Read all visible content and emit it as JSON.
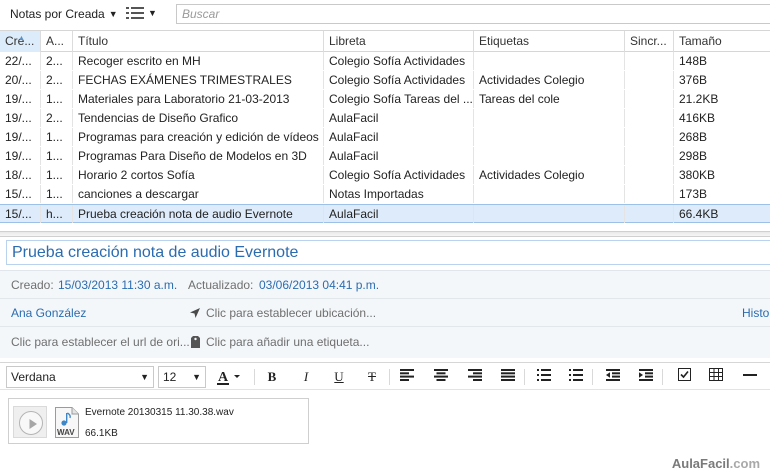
{
  "toolbar": {
    "sort_label": "Notas por Creada",
    "view_icon": "list-view-icon",
    "search_placeholder": "Buscar"
  },
  "table": {
    "columns": [
      "Cre...",
      "A...",
      "Título",
      "Libreta",
      "Etiquetas",
      "Sincr...",
      "Tamaño"
    ],
    "rows": [
      [
        "22/...",
        "2...",
        "Recoger escrito en MH",
        "Colegio Sofía Actividades",
        "",
        "",
        "148B"
      ],
      [
        "20/...",
        "2...",
        "FECHAS EXÁMENES TRIMESTRALES",
        "Colegio Sofía Actividades",
        "Actividades Colegio",
        "",
        "376B"
      ],
      [
        "19/...",
        "1...",
        "Materiales para Laboratorio 21-03-2013",
        "Colegio Sofía Tareas del ...",
        "Tareas del cole",
        "",
        "21.2KB"
      ],
      [
        "19/...",
        "2...",
        "Tendencias de Diseño Grafico",
        "AulaFacil",
        "",
        "",
        "416KB"
      ],
      [
        "19/...",
        "1...",
        "Programas para creación y edición de vídeos",
        "AulaFacil",
        "",
        "",
        "268B"
      ],
      [
        "19/...",
        "1...",
        "Programas Para Diseño de Modelos en 3D",
        "AulaFacil",
        "",
        "",
        "298B"
      ],
      [
        "18/...",
        "1...",
        "Horario 2 cortos Sofía",
        "Colegio Sofía Actividades",
        "Actividades Colegio",
        "",
        "380KB"
      ],
      [
        "15/...",
        "1...",
        "canciones a descargar",
        "Notas Importadas",
        "",
        "",
        "173B"
      ],
      [
        "15/...",
        "h...",
        "Prueba creación nota de audio Evernote",
        "AulaFacil",
        "",
        "",
        "66.4KB"
      ]
    ]
  },
  "note": {
    "title": "Prueba creación nota de audio Evernote",
    "created_label": "Creado:",
    "created_value": "15/03/2013 11:30 a.m.",
    "updated_label": "Actualizado:",
    "updated_value": "03/06/2013 04:41 p.m.",
    "author": "Ana González",
    "location_hint": "Clic para establecer ubicación...",
    "history_link": "Histo",
    "url_hint": "Clic para establecer el url de ori...",
    "tag_hint": "Clic para añadir una etiqueta..."
  },
  "format": {
    "font": "Verdana",
    "size": "12",
    "bold": "B",
    "italic": "I",
    "underline": "U",
    "strike": "T"
  },
  "attachment": {
    "filename": "Evernote 20130315 11.30.38.wav",
    "size": "66.1KB",
    "icon_label": "WAV"
  },
  "watermark": {
    "brand": "AulaFacil",
    "domain": ".com"
  }
}
